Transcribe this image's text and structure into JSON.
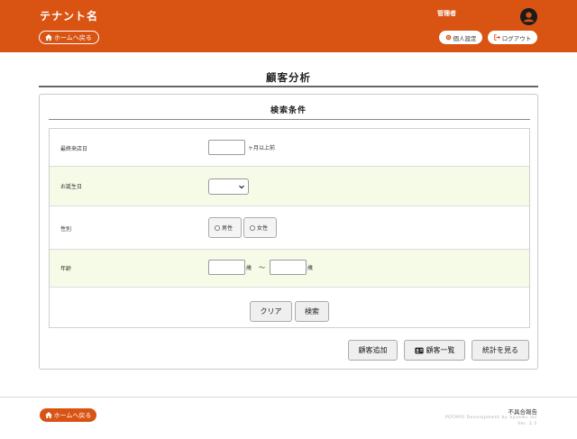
{
  "header": {
    "tenant_name": "テナント名",
    "home_label": "ホームへ戻る",
    "user_role": "管理者",
    "settings_label": "個人設定",
    "logout_label": "ログアウト"
  },
  "page": {
    "title": "顧客分析",
    "section_title": "検索条件"
  },
  "form": {
    "last_visit": {
      "label": "最終来店日",
      "value": "",
      "unit": "ヶ月以上前"
    },
    "birthday": {
      "label": "お誕生日",
      "selected": ""
    },
    "gender": {
      "label": "性別",
      "options": [
        "男性",
        "女性"
      ]
    },
    "age": {
      "label": "年齢",
      "from_value": "",
      "to_value": "",
      "unit_from": "歳",
      "separator": "～",
      "unit_to": "歳"
    }
  },
  "buttons": {
    "clear": "クリア",
    "search": "検索",
    "add_customer": "顧客追加",
    "customer_list": "顧客一覧",
    "view_stats": "統計を見る"
  },
  "footer": {
    "home_label": "ホームへ戻る",
    "report": "不具合報告",
    "powered": "POTAPO Development by ayuedu inc",
    "version": "Ver. 2.1"
  },
  "colors": {
    "brand": "#d95313",
    "row_highlight": "#f6fbe8"
  }
}
